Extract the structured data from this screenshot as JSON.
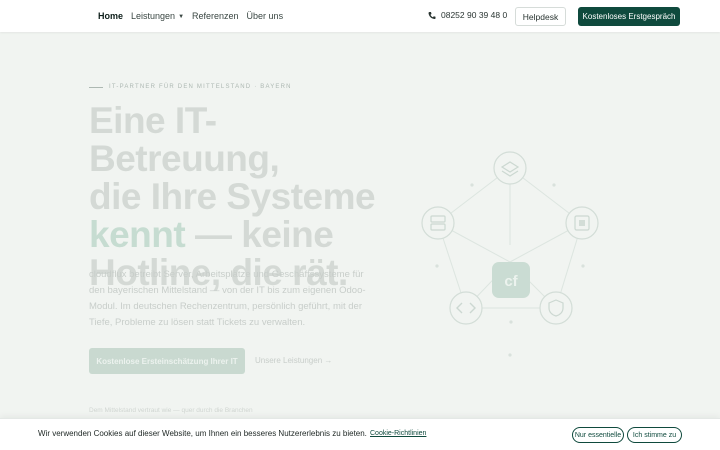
{
  "nav": {
    "items": [
      {
        "label": "Home",
        "active": true
      },
      {
        "label": "Leistungen",
        "has_dropdown": true
      },
      {
        "label": "Referenzen"
      },
      {
        "label": "Über uns"
      }
    ],
    "phone": "08252 90 39 48 0",
    "helpdesk_label": "Helpdesk",
    "cta_label": "Kostenloses Erstgespräch"
  },
  "hero": {
    "kicker": "IT-PARTNER FÜR DEN MITTELSTAND · BAYERN",
    "headline_line1": "Eine IT-Betreuung,",
    "headline_line2": "die Ihre Systeme",
    "headline_accent": "kennt",
    "headline_line3_rest": " — keine",
    "headline_line4": "Hotline, die rät.",
    "lead": "cloudflux betreibt Server, Arbeitsplätze und Geschäftssysteme für den bayerischen Mittelstand — von der IT bis zum eigenen Odoo-Modul. Im deutschen Rechenzentrum, persönlich geführt, mit der Tiefe, Probleme zu lösen statt Tickets zu verwalten.",
    "cta_label": "Kostenlose Ersteinschätzung Ihrer IT",
    "secondary_label": "Unsere Leistungen",
    "secondary_arrow": "→",
    "trust_text": "Dem Mittelstand vertraut wie — quer durch die Branchen",
    "diagram_center": "cf"
  },
  "cookie": {
    "text": "Wir verwenden Cookies auf dieser Website, um Ihnen ein besseres Nutzererlebnis zu bieten.",
    "link": "Cookie-Richtlinien",
    "essential_label": "Nur essentielle",
    "accept_label": "Ich stimme zu"
  },
  "colors": {
    "brand": "#0f4a3d",
    "accent_faded": "#b3d1c3"
  },
  "icons": [
    "phone-icon",
    "chevron-down-icon",
    "layers-icon",
    "server-icon",
    "chip-icon",
    "code-icon",
    "shield-icon",
    "arrow-right-icon"
  ]
}
